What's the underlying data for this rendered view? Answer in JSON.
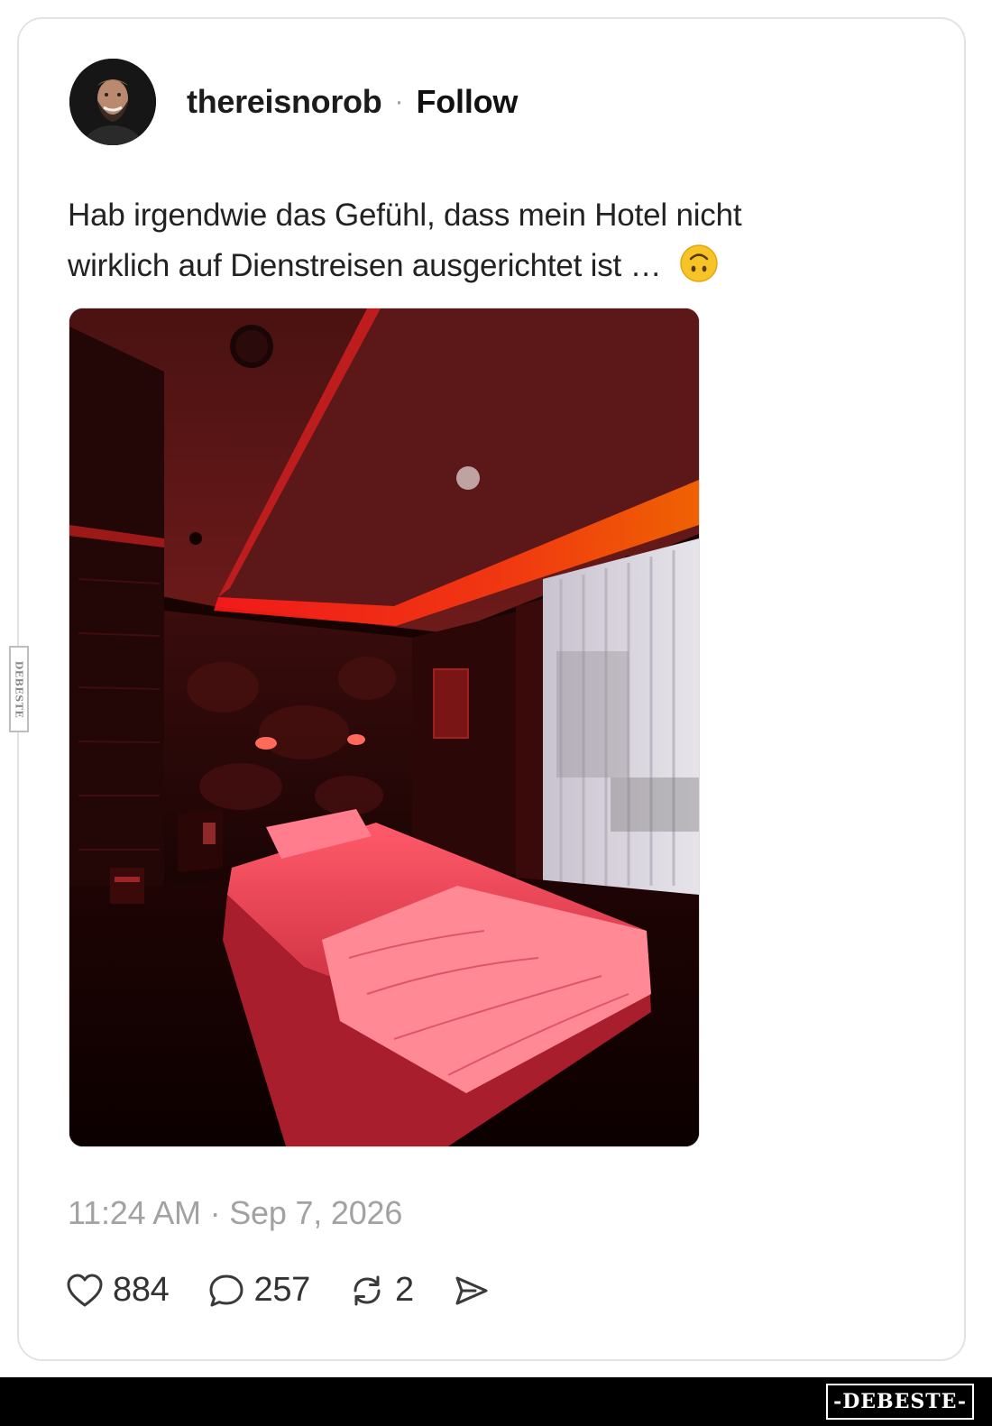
{
  "post": {
    "username": "thereisnorob",
    "separator": "·",
    "follow_label": "Follow",
    "text_line1": "Hab irgendwie das Gefühl, dass mein Hotel nicht",
    "text_line2": "wirklich auf Dienstreisen ausgerichtet ist …",
    "emoji_icon": "upside-down-face-emoji",
    "photo_description_icon": "hotel-room-red-light-photo",
    "timestamp": "11:24 AM · Sep 7, 2026"
  },
  "actions": {
    "likes_count": "884",
    "replies_count": "257",
    "reposts_count": "2",
    "like_icon": "heart-icon",
    "reply_icon": "speech-bubble-icon",
    "repost_icon": "repost-icon",
    "share_icon": "send-icon"
  },
  "watermarks": {
    "side_label": "DEBESTE",
    "footer_label": "-DEBESTE-"
  },
  "colors": {
    "text": "#222222",
    "muted": "#a2a2a2",
    "card_border": "#e3e3e3",
    "footer_bg": "#000000"
  }
}
